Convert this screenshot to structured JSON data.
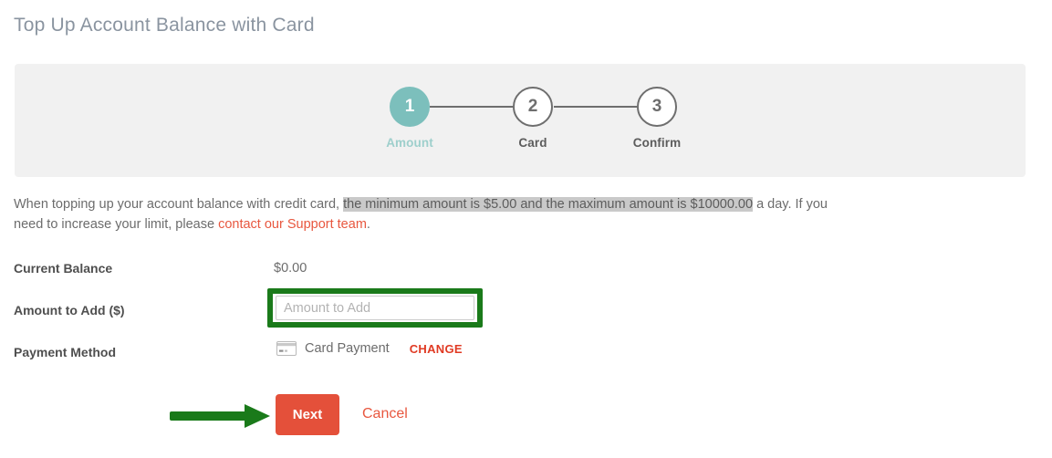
{
  "page": {
    "title": "Top Up Account Balance with Card"
  },
  "stepper": {
    "steps": [
      {
        "number": "1",
        "label": "Amount",
        "state": "active"
      },
      {
        "number": "2",
        "label": "Card",
        "state": "inactive"
      },
      {
        "number": "3",
        "label": "Confirm",
        "state": "inactive"
      }
    ]
  },
  "intro": {
    "part1": "When topping up your account balance with credit card, ",
    "highlighted": "the minimum amount is $5.00 and the maximum amount is $10000.00",
    "part2": " a day. If you need to increase your limit, please ",
    "link": "contact our Support team",
    "part3": "."
  },
  "form": {
    "current_balance_label": "Current Balance",
    "current_balance_value": "$0.00",
    "amount_label": "Amount to Add ($)",
    "amount_placeholder": "Amount to Add",
    "amount_value": "",
    "payment_label": "Payment Method",
    "payment_value": "Card Payment",
    "change_label": "CHANGE"
  },
  "actions": {
    "next_label": "Next",
    "cancel_label": "Cancel"
  },
  "annotations": {
    "highlight_color": "#1a7a1a",
    "arrow_color": "#1a7a1a",
    "selection_color": "#c9c9c9"
  },
  "colors": {
    "accent_red": "#e4503a",
    "link_red": "#e8573f",
    "step_active": "#7cbfbc",
    "panel_bg": "#f1f1f1"
  },
  "icons": {
    "card": "credit-card-icon",
    "arrow": "right-arrow-annotation"
  }
}
